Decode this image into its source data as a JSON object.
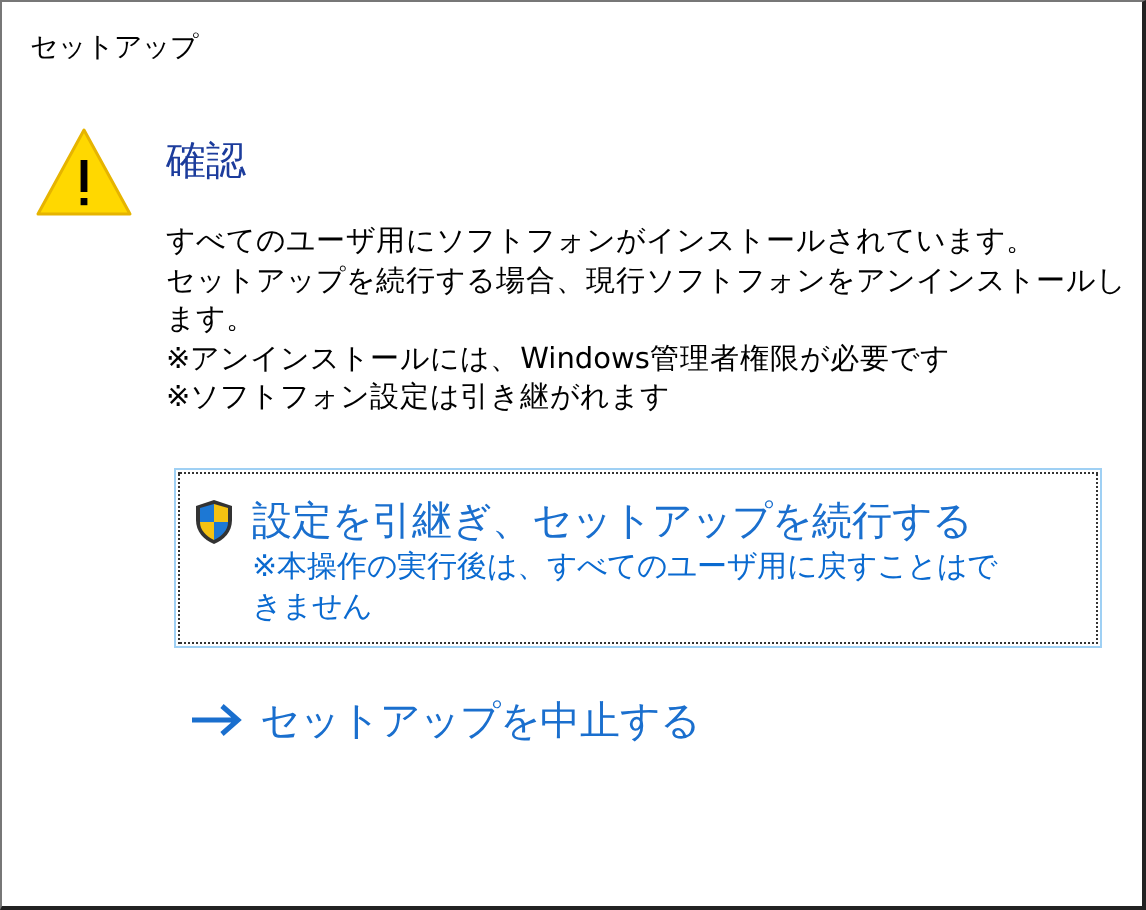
{
  "window": {
    "title": "セットアップ"
  },
  "heading": "確認",
  "message_lines": [
    "すべてのユーザ用にソフトフォンがインストールされています。",
    "セットアップを続行する場合、現行ソフトフォンをアンインストールし",
    "ます。",
    "※アンインストールには、Windows管理者権限が必要です",
    "※ソフトフォン設定は引き継がれます"
  ],
  "command_links": [
    {
      "kind": "shield",
      "label": "設定を引継ぎ、セットアップを続行する",
      "note_lines": [
        "※本操作の実行後は、すべてのユーザ用に戻すことはで",
        "きません"
      ],
      "focused": true
    },
    {
      "kind": "arrow",
      "label": "セットアップを中止する",
      "focused": false
    }
  ]
}
